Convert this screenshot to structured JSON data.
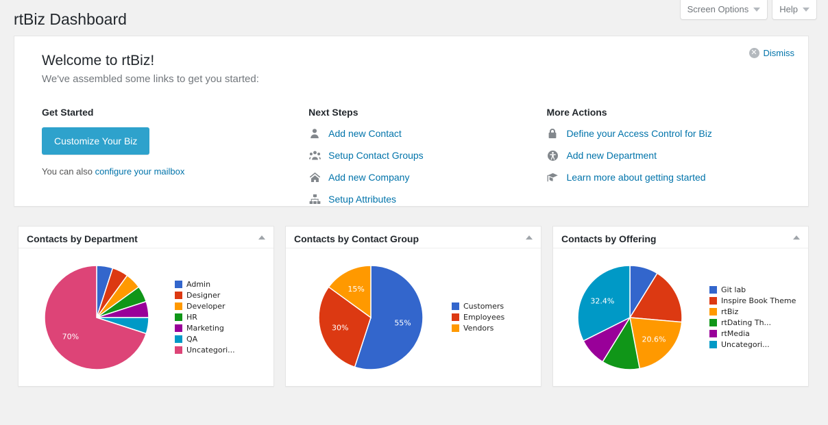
{
  "header": {
    "title": "rtBiz Dashboard",
    "screen_options_label": "Screen Options",
    "help_label": "Help"
  },
  "welcome": {
    "title": "Welcome to rtBiz!",
    "subtitle": "We've assembled some links to get you started:",
    "dismiss_label": "Dismiss",
    "dismiss_icon": "close-circle-icon",
    "get_started": {
      "heading": "Get Started",
      "button_label": "Customize Your Biz",
      "button_color": "#2ea2cc",
      "also_prefix": "You can also ",
      "also_link": "configure your mailbox"
    },
    "next_steps": {
      "heading": "Next Steps",
      "items": [
        {
          "label": "Add new Contact",
          "icon": "user-icon"
        },
        {
          "label": "Setup Contact Groups",
          "icon": "users-group-icon"
        },
        {
          "label": "Add new Company",
          "icon": "home-icon"
        },
        {
          "label": "Setup Attributes",
          "icon": "sitemap-icon"
        }
      ]
    },
    "more_actions": {
      "heading": "More Actions",
      "items": [
        {
          "label": "Define your Access Control for Biz",
          "icon": "lock-icon"
        },
        {
          "label": "Add new Department",
          "icon": "universal-access-icon"
        },
        {
          "label": "Learn more about getting started",
          "icon": "graduation-cap-icon"
        }
      ]
    }
  },
  "widgets": [
    {
      "title": "Contacts by Department",
      "toggle_icon": "chevron-up-icon"
    },
    {
      "title": "Contacts by Contact Group",
      "toggle_icon": "chevron-up-icon"
    },
    {
      "title": "Contacts by Offering",
      "toggle_icon": "chevron-up-icon"
    }
  ],
  "chart_data": [
    {
      "type": "pie",
      "title": "Contacts by Department",
      "categories": [
        "Admin",
        "Designer",
        "Developer",
        "HR",
        "Marketing",
        "QA",
        "Uncategori..."
      ],
      "values": [
        5,
        5,
        5,
        5,
        5,
        5,
        70
      ],
      "colors": [
        "#3366cc",
        "#dc3912",
        "#ff9900",
        "#109618",
        "#990099",
        "#0099c6",
        "#dd4477"
      ],
      "visible_labels": [
        {
          "category": "Uncategori...",
          "text": "70%"
        }
      ],
      "legend_position": "right",
      "legend": [
        "Admin",
        "Designer",
        "Developer",
        "HR",
        "Marketing",
        "QA",
        "Uncategori..."
      ]
    },
    {
      "type": "pie",
      "title": "Contacts by Contact Group",
      "categories": [
        "Customers",
        "Employees",
        "Vendors"
      ],
      "values": [
        55,
        30,
        15
      ],
      "colors": [
        "#3366cc",
        "#dc3912",
        "#ff9900"
      ],
      "visible_labels": [
        {
          "category": "Customers",
          "text": "55%"
        },
        {
          "category": "Employees",
          "text": "30%"
        },
        {
          "category": "Vendors",
          "text": "15%"
        }
      ],
      "legend_position": "right",
      "legend": [
        "Customers",
        "Employees",
        "Vendors"
      ]
    },
    {
      "type": "pie",
      "title": "Contacts by Offering",
      "categories": [
        "Git lab",
        "Inspire Book Theme",
        "rtBiz",
        "rtDating Th...",
        "rtMedia",
        "Uncategori..."
      ],
      "values": [
        8.8,
        17.6,
        20.6,
        11.8,
        8.8,
        32.4
      ],
      "colors": [
        "#3366cc",
        "#dc3912",
        "#ff9900",
        "#109618",
        "#990099",
        "#0099c6"
      ],
      "visible_labels": [
        {
          "category": "rtBiz",
          "text": "20.6%"
        },
        {
          "category": "Uncategori...",
          "text": "32.4%"
        }
      ],
      "legend_position": "right",
      "legend": [
        "Git lab",
        "Inspire Book Theme",
        "rtBiz",
        "rtDating Th...",
        "rtMedia",
        "Uncategori..."
      ]
    }
  ]
}
